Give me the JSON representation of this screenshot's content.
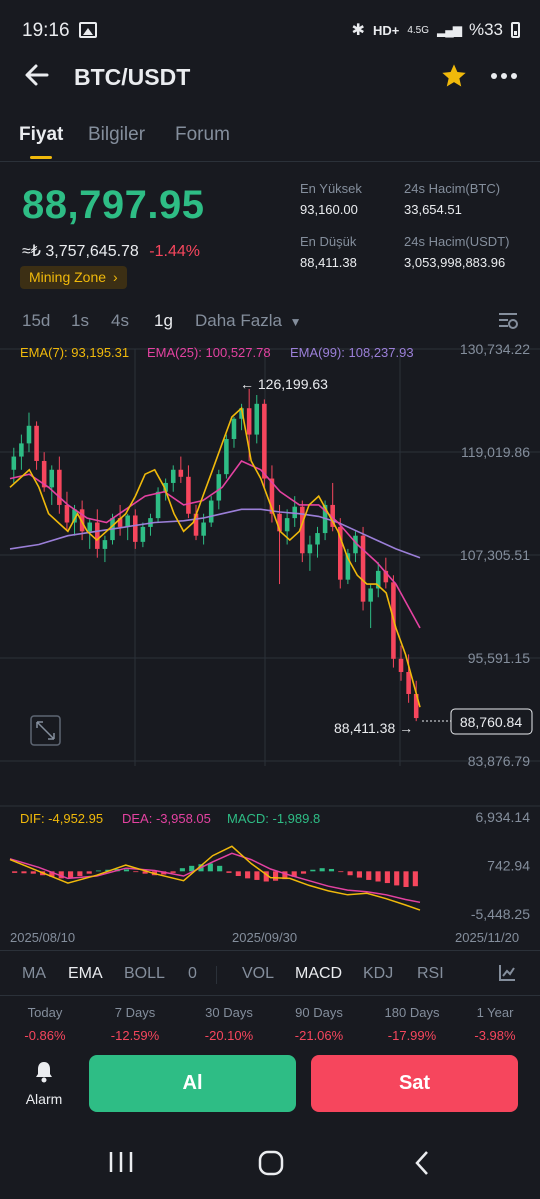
{
  "status_bar": {
    "time": "19:16",
    "network": "4.5G",
    "battery": "%33"
  },
  "header": {
    "pair": "BTC/USDT"
  },
  "tabs": [
    {
      "label": "Fiyat",
      "active": true
    },
    {
      "label": "Bilgiler",
      "active": false
    },
    {
      "label": "Forum",
      "active": false
    }
  ],
  "ticker": {
    "last_price": "88,797.95",
    "price_try": "≈₺ 3,757,645.78",
    "change_pct": "-1.44%",
    "badge": "Mining Zone",
    "high_label": "En Yüksek",
    "high_value": "93,160.00",
    "vol_btc_label": "24s Hacim(BTC)",
    "vol_btc_value": "33,654.51",
    "low_label": "En Düşük",
    "low_value": "88,411.38",
    "vol_usdt_label": "24s Hacim(USDT)",
    "vol_usdt_value": "3,053,998,883.96"
  },
  "intervals": [
    "15d",
    "1s",
    "4s",
    "1g"
  ],
  "interval_more": "Daha Fazla",
  "active_interval": "1g",
  "chart_data": {
    "type": "candlestick",
    "ema_legend": {
      "ema7": "EMA(7): 93,195.31",
      "ema25": "EMA(25): 100,527.78",
      "ema99": "EMA(99): 108,237.93"
    },
    "price_axis": [
      "130,734.22",
      "119,019.86",
      "107,305.51",
      "95,591.15",
      "83,876.79"
    ],
    "price_range": [
      83876.79,
      130734.22
    ],
    "high_annotation": "126,199.63",
    "low_annotation": "88,411.38",
    "last_price_tag": "88,760.84",
    "ema7_path": [
      [
        0,
        115000
      ],
      [
        2,
        116000
      ],
      [
        4,
        117000
      ],
      [
        6,
        115000
      ],
      [
        8,
        112000
      ],
      [
        10,
        111000
      ],
      [
        12,
        110000
      ],
      [
        13,
        111000
      ],
      [
        14,
        112000
      ],
      [
        16,
        110000
      ],
      [
        18,
        109000
      ],
      [
        20,
        110000
      ],
      [
        22,
        111000
      ],
      [
        24,
        112000
      ],
      [
        26,
        114000
      ],
      [
        28,
        116500
      ],
      [
        30,
        117000
      ],
      [
        32,
        115000
      ],
      [
        34,
        112000
      ],
      [
        36,
        110000
      ],
      [
        38,
        111000
      ],
      [
        40,
        114000
      ],
      [
        42,
        117000
      ],
      [
        44,
        120000
      ],
      [
        46,
        123000
      ],
      [
        48,
        124000
      ],
      [
        49,
        121000
      ],
      [
        50,
        118000
      ],
      [
        52,
        116000
      ],
      [
        54,
        113000
      ],
      [
        56,
        110000
      ],
      [
        58,
        109000
      ],
      [
        60,
        110000
      ],
      [
        62,
        113000
      ],
      [
        64,
        114000
      ],
      [
        66,
        112000
      ],
      [
        68,
        110000
      ],
      [
        70,
        107000
      ],
      [
        72,
        105000
      ],
      [
        74,
        104000
      ],
      [
        76,
        104000
      ],
      [
        78,
        103000
      ],
      [
        80,
        99000
      ],
      [
        82,
        96000
      ],
      [
        84,
        92000
      ],
      [
        85,
        90000
      ]
    ],
    "ema25_path": [
      [
        0,
        116000
      ],
      [
        4,
        116500
      ],
      [
        8,
        115000
      ],
      [
        12,
        113000
      ],
      [
        16,
        111500
      ],
      [
        20,
        111000
      ],
      [
        24,
        112500
      ],
      [
        28,
        114000
      ],
      [
        32,
        114500
      ],
      [
        36,
        113000
      ],
      [
        40,
        113500
      ],
      [
        44,
        115000
      ],
      [
        48,
        118000
      ],
      [
        52,
        117000
      ],
      [
        56,
        114500
      ],
      [
        60,
        113000
      ],
      [
        64,
        113000
      ],
      [
        68,
        111000
      ],
      [
        72,
        108500
      ],
      [
        76,
        106500
      ],
      [
        80,
        104000
      ],
      [
        85,
        99000
      ]
    ],
    "ema99_path": [
      [
        0,
        108000
      ],
      [
        6,
        108500
      ],
      [
        12,
        109500
      ],
      [
        18,
        110000
      ],
      [
        24,
        110500
      ],
      [
        30,
        111000
      ],
      [
        36,
        111200
      ],
      [
        40,
        111500
      ],
      [
        44,
        112000
      ],
      [
        48,
        112500
      ],
      [
        52,
        112500
      ],
      [
        56,
        112200
      ],
      [
        60,
        112000
      ],
      [
        64,
        111700
      ],
      [
        68,
        111000
      ],
      [
        72,
        110000
      ],
      [
        76,
        109000
      ],
      [
        80,
        108000
      ],
      [
        85,
        107000
      ]
    ],
    "series_names": [
      "EMA(7)",
      "EMA(25)",
      "EMA(99)"
    ],
    "x_labels": [
      "2025/08/10",
      "2025/09/30",
      "2025/11/20"
    ],
    "candles": [
      [
        117000,
        119500,
        115500,
        118500
      ],
      [
        118500,
        121000,
        117000,
        120000
      ],
      [
        120000,
        123500,
        119000,
        122000
      ],
      [
        122000,
        122500,
        117000,
        118000
      ],
      [
        118000,
        119000,
        114500,
        115000
      ],
      [
        115000,
        117500,
        113000,
        117000
      ],
      [
        117000,
        118500,
        112000,
        113000
      ],
      [
        113000,
        114500,
        110000,
        111000
      ],
      [
        111000,
        113000,
        109500,
        112500
      ],
      [
        112500,
        113500,
        109000,
        110000
      ],
      [
        110000,
        111500,
        108000,
        111000
      ],
      [
        111000,
        112500,
        107000,
        108000
      ],
      [
        108000,
        109500,
        106500,
        109000
      ],
      [
        109000,
        112000,
        108500,
        111500
      ],
      [
        111500,
        113000,
        109500,
        110500
      ],
      [
        110500,
        112000,
        109000,
        111800
      ],
      [
        111800,
        112500,
        108000,
        108800
      ],
      [
        108800,
        111000,
        108200,
        110500
      ],
      [
        110500,
        112000,
        109500,
        111500
      ],
      [
        111500,
        115000,
        111000,
        114500
      ],
      [
        114500,
        116000,
        113500,
        115500
      ],
      [
        115500,
        117500,
        114500,
        117000
      ],
      [
        117000,
        118500,
        115500,
        116200
      ],
      [
        116200,
        117500,
        111500,
        112000
      ],
      [
        112000,
        113000,
        109000,
        109500
      ],
      [
        109500,
        112000,
        108500,
        111000
      ],
      [
        111000,
        114000,
        110500,
        113500
      ],
      [
        113500,
        117000,
        112500,
        116500
      ],
      [
        116500,
        121000,
        116000,
        120500
      ],
      [
        120500,
        123000,
        119500,
        122800
      ],
      [
        122800,
        124500,
        121500,
        124000
      ],
      [
        124000,
        126199.63,
        118000,
        121000
      ],
      [
        121000,
        125500,
        120000,
        124500
      ],
      [
        124500,
        125000,
        115000,
        116000
      ],
      [
        116000,
        117500,
        111000,
        112000
      ],
      [
        112000,
        113000,
        104000,
        110000
      ],
      [
        110000,
        112500,
        108500,
        111500
      ],
      [
        111500,
        114000,
        110500,
        112800
      ],
      [
        112800,
        113500,
        106500,
        107500
      ],
      [
        107500,
        109500,
        105500,
        108500
      ],
      [
        108500,
        110500,
        107000,
        109800
      ],
      [
        109800,
        113500,
        109000,
        113000
      ],
      [
        113000,
        115500,
        110000,
        110500
      ],
      [
        110500,
        111500,
        103500,
        104500
      ],
      [
        104500,
        108000,
        104000,
        107500
      ],
      [
        107500,
        110000,
        106500,
        109500
      ],
      [
        109500,
        110500,
        101000,
        102000
      ],
      [
        102000,
        104000,
        99000,
        103500
      ],
      [
        103500,
        106500,
        102500,
        105500
      ],
      [
        105500,
        107000,
        103500,
        104200
      ],
      [
        104200,
        105000,
        94500,
        95500
      ],
      [
        95500,
        97000,
        93000,
        94000
      ],
      [
        94000,
        96000,
        90500,
        91500
      ],
      [
        91500,
        93000,
        88411.38,
        88760.84
      ]
    ],
    "macd": {
      "dif_label": "DIF: -4,952.95",
      "dea_label": "DEA: -3,958.05",
      "macd_label": "MACD: -1,989.8",
      "axis": [
        "6,934.14",
        "742.94",
        "-5,448.25"
      ],
      "range": [
        -5448.25,
        6934.14
      ],
      "dif_path": [
        [
          0,
          1500
        ],
        [
          6,
          0
        ],
        [
          12,
          -1500
        ],
        [
          18,
          -500
        ],
        [
          24,
          800
        ],
        [
          30,
          -300
        ],
        [
          36,
          -1200
        ],
        [
          42,
          2000
        ],
        [
          46,
          3200
        ],
        [
          50,
          1000
        ],
        [
          54,
          -800
        ],
        [
          58,
          -900
        ],
        [
          62,
          -1800
        ],
        [
          66,
          -2500
        ],
        [
          70,
          -3000
        ],
        [
          74,
          -2800
        ],
        [
          78,
          -3500
        ],
        [
          82,
          -4300
        ],
        [
          85,
          -4952.95
        ]
      ],
      "dea_path": [
        [
          0,
          1600
        ],
        [
          6,
          500
        ],
        [
          12,
          -900
        ],
        [
          18,
          -600
        ],
        [
          24,
          400
        ],
        [
          30,
          100
        ],
        [
          36,
          -600
        ],
        [
          42,
          1200
        ],
        [
          46,
          2300
        ],
        [
          50,
          1500
        ],
        [
          54,
          300
        ],
        [
          58,
          -500
        ],
        [
          62,
          -1200
        ],
        [
          66,
          -1900
        ],
        [
          70,
          -2400
        ],
        [
          74,
          -2600
        ],
        [
          78,
          -3000
        ],
        [
          82,
          -3600
        ],
        [
          85,
          -3958.05
        ]
      ],
      "hist": [
        -200,
        -250,
        -300,
        -500,
        -700,
        -900,
        -800,
        -600,
        -300,
        100,
        200,
        300,
        250,
        -100,
        -300,
        -500,
        -400,
        -200,
        400,
        700,
        900,
        1000,
        700,
        -200,
        -600,
        -900,
        -1100,
        -1300,
        -1200,
        -1000,
        -700,
        -300,
        200,
        400,
        300,
        -100,
        -500,
        -800,
        -1100,
        -1300,
        -1500,
        -1800,
        -2000,
        -1900
      ]
    }
  },
  "indicators_main": [
    "MA",
    "EMA",
    "BOLL",
    "0"
  ],
  "indicators_sub": [
    "VOL",
    "MACD",
    "KDJ",
    "RSI"
  ],
  "active_indicators": [
    "EMA",
    "MACD"
  ],
  "performance": [
    {
      "label": "Today",
      "value": "-0.86%"
    },
    {
      "label": "7 Days",
      "value": "-12.59%"
    },
    {
      "label": "30 Days",
      "value": "-20.10%"
    },
    {
      "label": "90 Days",
      "value": "-21.06%"
    },
    {
      "label": "180 Days",
      "value": "-17.99%"
    },
    {
      "label": "1 Year",
      "value": "-3.98%"
    }
  ],
  "actions": {
    "alarm_label": "Alarm",
    "buy_label": "Al",
    "sell_label": "Sat"
  },
  "colors": {
    "up": "#2ebd85",
    "down": "#f6465d",
    "accent": "#f0b90b",
    "ema7": "#f0b90b",
    "ema25": "#e442a1",
    "ema99": "#9b7fd8"
  }
}
